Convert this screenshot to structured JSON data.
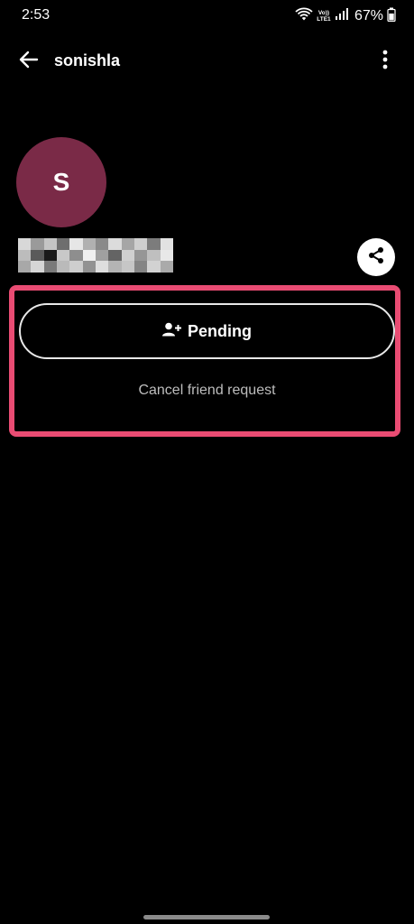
{
  "status_bar": {
    "time": "2:53",
    "volte_top": "Vo))",
    "volte_bottom": "LTE1",
    "battery": "67%",
    "icons": [
      "wifi-icon",
      "signal-icon",
      "battery-icon"
    ]
  },
  "app_bar": {
    "title": "sonishla",
    "back_icon": "arrow-left-icon",
    "menu_icon": "more-vertical-icon"
  },
  "profile": {
    "avatar_initial": "S",
    "avatar_color": "#7a2a47",
    "share_icon": "share-icon"
  },
  "actions": {
    "pending_label": "Pending",
    "pending_icon": "person-add-icon",
    "cancel_label": "Cancel friend request"
  },
  "colors": {
    "highlight": "#e94c73",
    "background": "#000000"
  }
}
